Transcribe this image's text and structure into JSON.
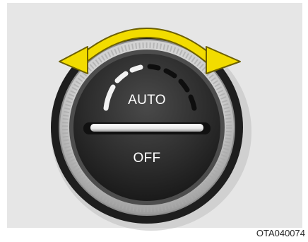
{
  "knob": {
    "auto_label": "AUTO",
    "off_label": "OFF",
    "rotation_arrow": "double-headed-curved-arrow",
    "arrow_color": "#f2dc00",
    "face_color": "#2a2a2a",
    "ring_color": "#c8c8c8",
    "indicator_color": "#ffffff"
  },
  "image_code": "OTA040074"
}
